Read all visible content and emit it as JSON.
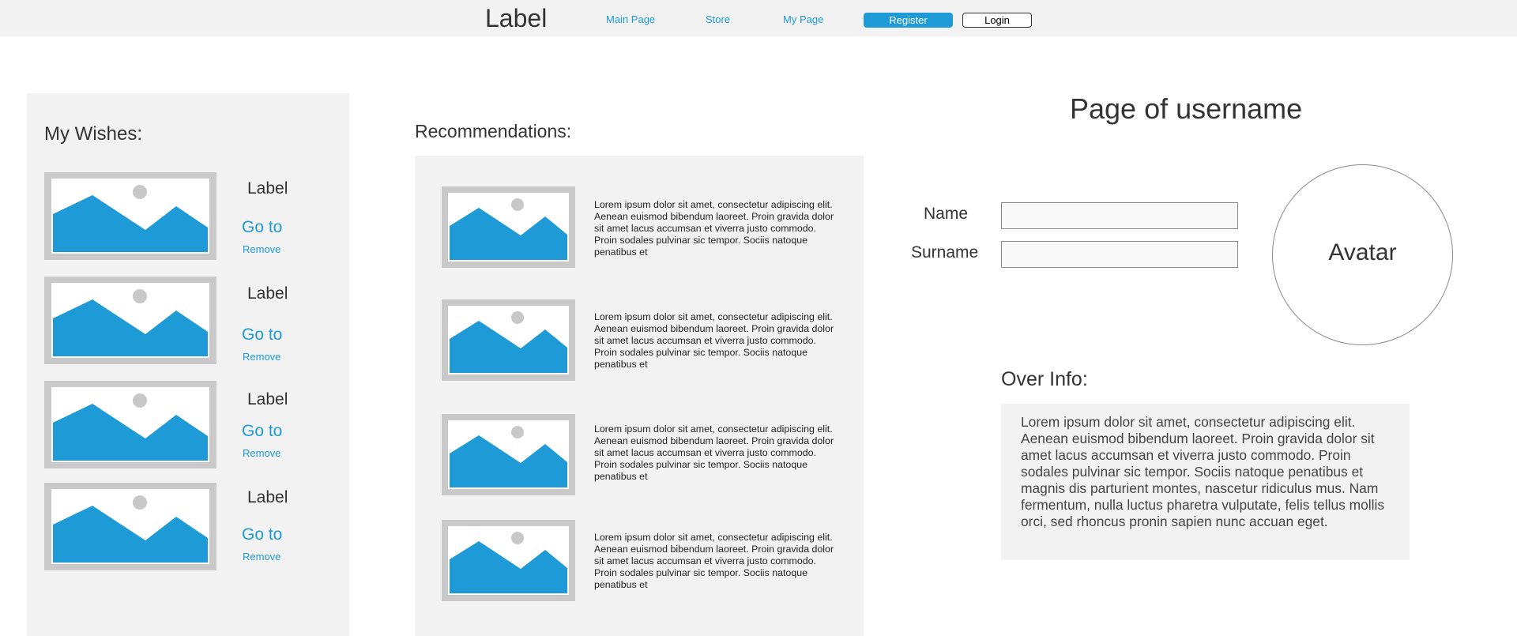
{
  "header": {
    "logo": "Label",
    "nav": [
      "Main Page",
      "Store",
      "My Page"
    ],
    "register_label": "Register",
    "login_label": "Login"
  },
  "wishes": {
    "title": "My Wishes:",
    "items": [
      {
        "label": "Label",
        "goto": "Go to",
        "remove": "Remove"
      },
      {
        "label": "Label",
        "goto": "Go to",
        "remove": "Remove"
      },
      {
        "label": "Label",
        "goto": "Go to",
        "remove": "Remove"
      },
      {
        "label": "Label",
        "goto": "Go to",
        "remove": "Remove"
      }
    ]
  },
  "recommendations": {
    "title": "Recommendations:",
    "items": [
      {
        "text": "Lorem ipsum dolor sit amet, consectetur adipiscing elit. Aenean euismod bibendum laoreet. Proin gravida dolor sit amet lacus accumsan et viverra justo commodo. Proin sodales pulvinar sic tempor. Sociis natoque penatibus et"
      },
      {
        "text": "Lorem ipsum dolor sit amet, consectetur adipiscing elit. Aenean euismod bibendum laoreet. Proin gravida dolor sit amet lacus accumsan et viverra justo commodo. Proin sodales pulvinar sic tempor. Sociis natoque penatibus et"
      },
      {
        "text": "Lorem ipsum dolor sit amet, consectetur adipiscing elit. Aenean euismod bibendum laoreet. Proin gravida dolor sit amet lacus accumsan et viverra justo commodo. Proin sodales pulvinar sic tempor. Sociis natoque penatibus et"
      },
      {
        "text": "Lorem ipsum dolor sit amet, consectetur adipiscing elit. Aenean euismod bibendum laoreet. Proin gravida dolor sit amet lacus accumsan et viverra justo commodo. Proin sodales pulvinar sic tempor. Sociis natoque penatibus et"
      }
    ]
  },
  "profile": {
    "title": "Page of username",
    "name_label": "Name",
    "name_value": "",
    "surname_label": "Surname",
    "surname_value": "",
    "avatar_label": "Avatar",
    "over_info_title": "Over Info:",
    "over_info_text": "Lorem ipsum dolor sit amet, consectetur adipiscing elit. Aenean euismod bibendum laoreet. Proin gravida dolor sit amet lacus accumsan et viverra justo commodo. Proin sodales pulvinar sic tempor. Sociis natoque penatibus et magnis dis parturient montes, nascetur ridiculus mus. Nam fermentum, nulla luctus pharetra vulputate, felis tellus mollis orci, sed rhoncus pronin sapien nunc accuan eget."
  },
  "icons": {
    "image_placeholder": "image-placeholder-icon"
  },
  "colors": {
    "accent": "#1e9ad6",
    "panel": "#f2f2f2",
    "placeholder_frame": "#c9c9c9",
    "sun": "#c8c8c8"
  }
}
